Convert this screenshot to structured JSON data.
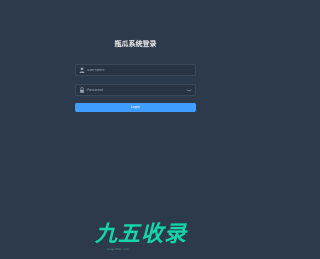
{
  "login": {
    "title": "瓶瓜系统登录",
    "username_placeholder": "username",
    "password_placeholder": "Password",
    "login_label": "Login"
  },
  "watermark": {
    "logo_text": "九五收录",
    "caption": "www.95sl.com"
  },
  "colors": {
    "background": "#2d3a4b",
    "input_background": "#283443",
    "button": "#409eff",
    "watermark": "#14d6a8"
  },
  "icons": {
    "username": "user-icon",
    "password": "lock-icon",
    "show_password": "eye-icon"
  }
}
